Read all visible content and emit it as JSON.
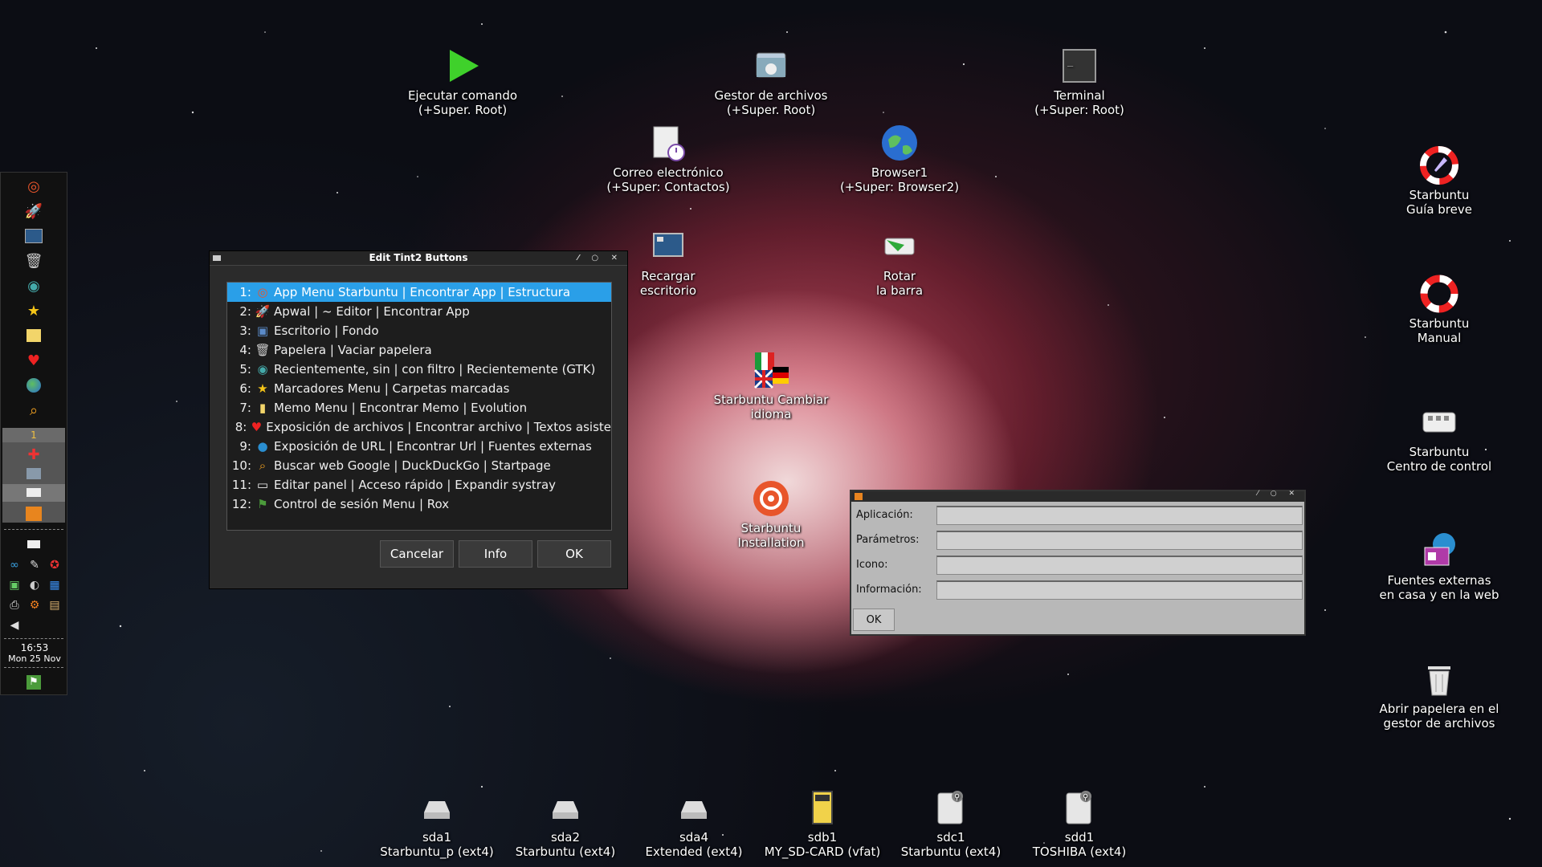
{
  "desktop": {
    "icons": [
      {
        "id": "run",
        "line1": "Ejecutar comando",
        "line2": "(+Super. Root)"
      },
      {
        "id": "files",
        "line1": "Gestor de archivos",
        "line2": "(+Super. Root)"
      },
      {
        "id": "terminal",
        "line1": "Terminal",
        "line2": "(+Super: Root)"
      },
      {
        "id": "mail",
        "line1": "Correo electrónico",
        "line2": "(+Super: Contactos)"
      },
      {
        "id": "browser",
        "line1": "Browser1",
        "line2": "(+Super: Browser2)"
      },
      {
        "id": "reload",
        "line1": "Recargar",
        "line2": "escritorio"
      },
      {
        "id": "rotate",
        "line1": "Rotar",
        "line2": "la barra"
      },
      {
        "id": "language",
        "line1": "Starbuntu Cambiar",
        "line2": "idioma"
      },
      {
        "id": "install",
        "line1": "Starbuntu",
        "line2": "Installation"
      },
      {
        "id": "guide",
        "line1": "Starbuntu",
        "line2": "Guía breve"
      },
      {
        "id": "manual",
        "line1": "Starbuntu",
        "line2": "Manual"
      },
      {
        "id": "control",
        "line1": "Starbuntu",
        "line2": "Centro de control"
      },
      {
        "id": "external",
        "line1": "Fuentes externas",
        "line2": "en casa y en la web"
      },
      {
        "id": "trash",
        "line1": "Abrir papelera en el",
        "line2": "gestor de archivos"
      }
    ],
    "drives": [
      {
        "line1": "sda1",
        "line2": "Starbuntu_p (ext4)"
      },
      {
        "line1": "sda2",
        "line2": "Starbuntu (ext4)"
      },
      {
        "line1": "sda4",
        "line2": "Extended (ext4)"
      },
      {
        "line1": "sdb1",
        "line2": "MY_SD-CARD (vfat)"
      },
      {
        "line1": "sdc1",
        "line2": "Starbuntu (ext4)"
      },
      {
        "line1": "sdd1",
        "line2": "TOSHIBA (ext4)"
      }
    ]
  },
  "panel": {
    "desktop_number": "1",
    "clock_time": "16:53",
    "clock_date": "Mon 25 Nov"
  },
  "tint2_dialog": {
    "title": "Edit Tint2 Buttons",
    "items": [
      {
        "num": "1:",
        "label": "App Menu Starbuntu | Encontrar App | Estructura",
        "icon": "starbuntu-icon"
      },
      {
        "num": "2:",
        "label": "Apwal | ~ Editor | Encontrar App",
        "icon": "rocket-icon"
      },
      {
        "num": "3:",
        "label": "Escritorio | Fondo",
        "icon": "desktop-icon"
      },
      {
        "num": "4:",
        "label": "Papelera | Vaciar papelera",
        "icon": "trash-icon"
      },
      {
        "num": "5:",
        "label": "Recientemente, sin | con filtro | Recientemente (GTK)",
        "icon": "recent-icon"
      },
      {
        "num": "6:",
        "label": "Marcadores Menu | Carpetas marcadas",
        "icon": "star-icon"
      },
      {
        "num": "7:",
        "label": "Memo Menu | Encontrar Memo | Evolution",
        "icon": "memo-icon"
      },
      {
        "num": "8:",
        "label": "Exposición de archivos | Encontrar archivo | Textos asiste",
        "icon": "heart-icon"
      },
      {
        "num": "9:",
        "label": "Exposición de URL | Encontrar Url | Fuentes externas",
        "icon": "globe-icon"
      },
      {
        "num": "10:",
        "label": "Buscar web Google | DuckDuckGo | Startpage",
        "icon": "search-icon"
      },
      {
        "num": "11:",
        "label": "Editar panel | Acceso rápido | Expandir systray",
        "icon": "panel-icon"
      },
      {
        "num": "12:",
        "label": "Control de sesión Menu | Rox",
        "icon": "exit-icon"
      }
    ],
    "buttons": {
      "cancel": "Cancelar",
      "info": "Info",
      "ok": "OK"
    }
  },
  "run_dialog": {
    "fields": [
      {
        "label": "Aplicación:",
        "value": ""
      },
      {
        "label": "Parámetros:",
        "value": ""
      },
      {
        "label": "Icono:",
        "value": ""
      },
      {
        "label": "Información:",
        "value": ""
      }
    ],
    "ok_label": "OK"
  }
}
